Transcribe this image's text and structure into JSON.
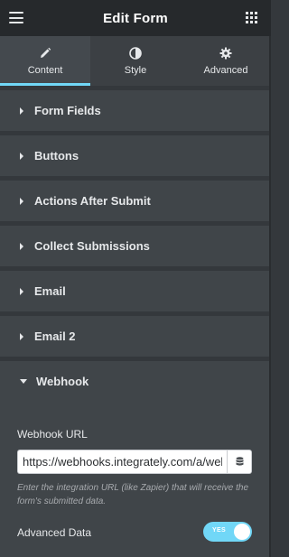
{
  "header": {
    "title": "Edit Form",
    "menu_icon": "hamburger-menu-icon",
    "apps_icon": "grid-apps-icon"
  },
  "tabs": [
    {
      "label": "Content",
      "icon": "pencil-icon",
      "active": true
    },
    {
      "label": "Style",
      "icon": "half-circle-contrast-icon",
      "active": false
    },
    {
      "label": "Advanced",
      "icon": "gear-icon",
      "active": false
    }
  ],
  "sections": [
    {
      "label": "Form Fields",
      "expanded": false
    },
    {
      "label": "Buttons",
      "expanded": false
    },
    {
      "label": "Actions After Submit",
      "expanded": false
    },
    {
      "label": "Collect Submissions",
      "expanded": false
    },
    {
      "label": "Email",
      "expanded": false
    },
    {
      "label": "Email 2",
      "expanded": false
    },
    {
      "label": "Webhook",
      "expanded": true
    }
  ],
  "webhook": {
    "url_label": "Webhook URL",
    "url_value": "https://webhooks.integrately.com/a/webhooks/",
    "help_text": "Enter the integration URL (like Zapier) that will receive the form's submitted data.",
    "advanced_label": "Advanced Data",
    "toggle_text": "YES",
    "toggle_on": true
  },
  "colors": {
    "accent": "#71d7f7",
    "panel_bg": "#404549",
    "page_bg": "#34383c",
    "header_bg": "#26292c"
  }
}
